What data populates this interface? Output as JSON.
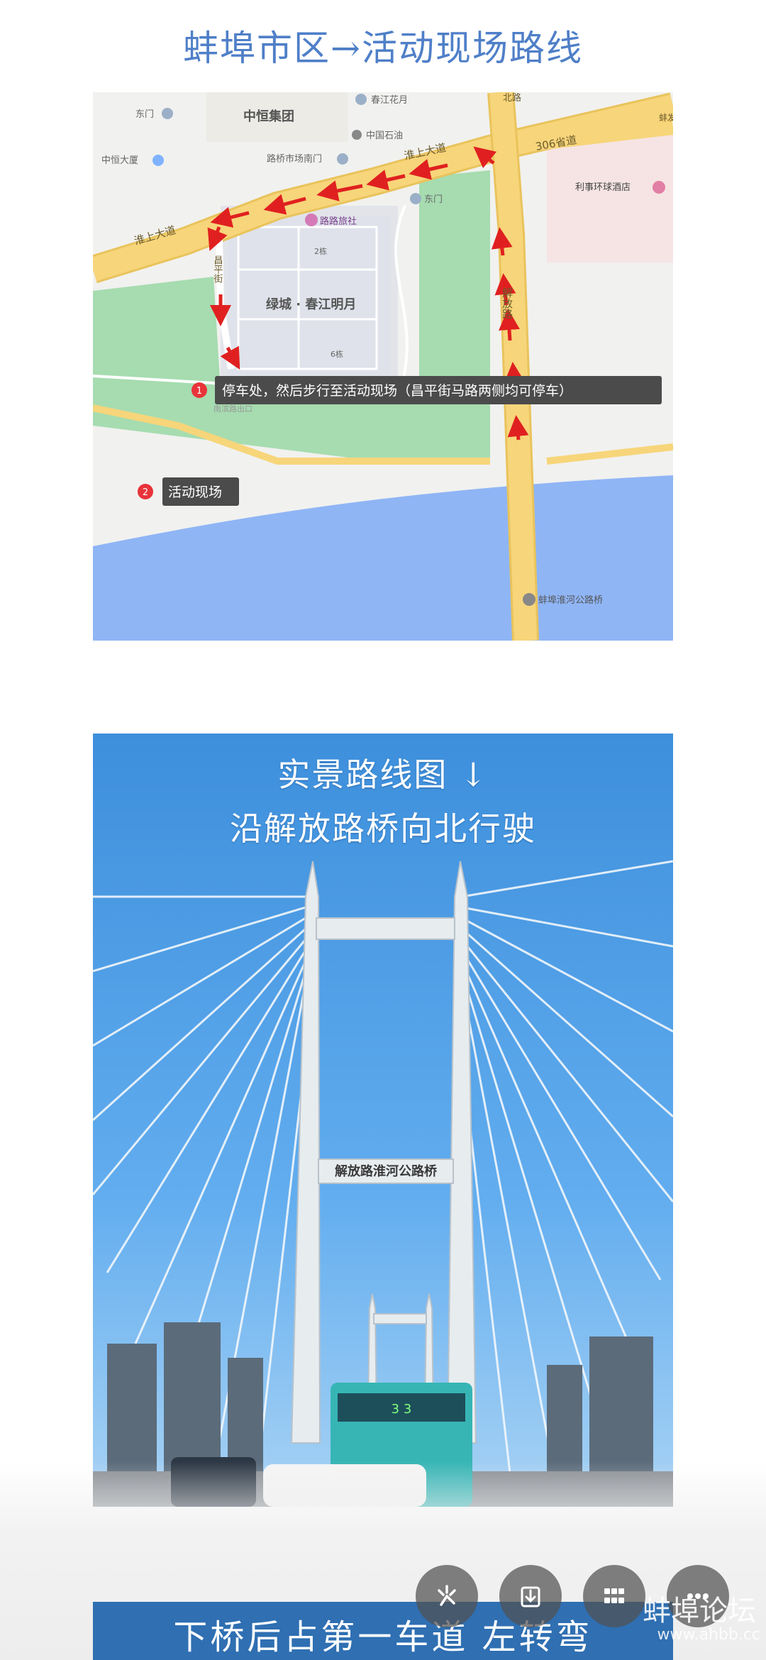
{
  "page": {
    "title": "蚌埠市区→活动现场路线"
  },
  "map": {
    "places": {
      "dongmen_top": "东门",
      "zhongheng_group": "中恒集团",
      "chunjiang_huayue": "春江花月",
      "zhongguo_shiyou": "中国石油",
      "zhongheng_building": "中恒大厦",
      "luqiao_market_south_gate": "路桥市场南门",
      "lizhi_hotel": "利事环球酒店",
      "dongmen_mid": "东门",
      "luqiao_hotel": "路路旅社",
      "building_2": "2栋",
      "lvcheng": "绿城 · 春江明月",
      "building_6": "6栋",
      "bridge_name": "蚌埠淮河公路桥",
      "small_road": "南滨路出口"
    },
    "roads": {
      "huaishang_left": "淮上大道",
      "huaishang_right": "淮上大道",
      "provincial_306": "306省道",
      "changping": "昌平街",
      "jiefang": "解放路",
      "north_edge": "北路",
      "fa_edge": "蚌发"
    },
    "markers": [
      {
        "number": "1",
        "label": "停车处，然后步行至活动现场（昌平街马路两侧均可停车）"
      },
      {
        "number": "2",
        "label": "活动现场"
      }
    ],
    "colors": {
      "road": "#f7d57a",
      "road_edge": "#e9c35c",
      "park": "#a6dcb0",
      "river": "#8fb5f5",
      "route": "#e02020",
      "marker": "#e8333a"
    }
  },
  "photo": {
    "caption_line1": "实景路线图 ↓",
    "caption_line2": "沿解放路桥向北行驶",
    "bridge_sign": "解放路淮河公路桥",
    "bus_display": "3 3",
    "sky_color": "#4a9ee3"
  },
  "bottom": {
    "caption": "下桥后占第一车道 左转弯"
  },
  "fabs": [
    {
      "icon": "sparkle-icon"
    },
    {
      "icon": "download-icon"
    },
    {
      "icon": "grid-icon"
    },
    {
      "icon": "more-icon"
    }
  ],
  "watermark": {
    "main": "蚌埠论坛",
    "sub": "www.ahbb.cc"
  }
}
